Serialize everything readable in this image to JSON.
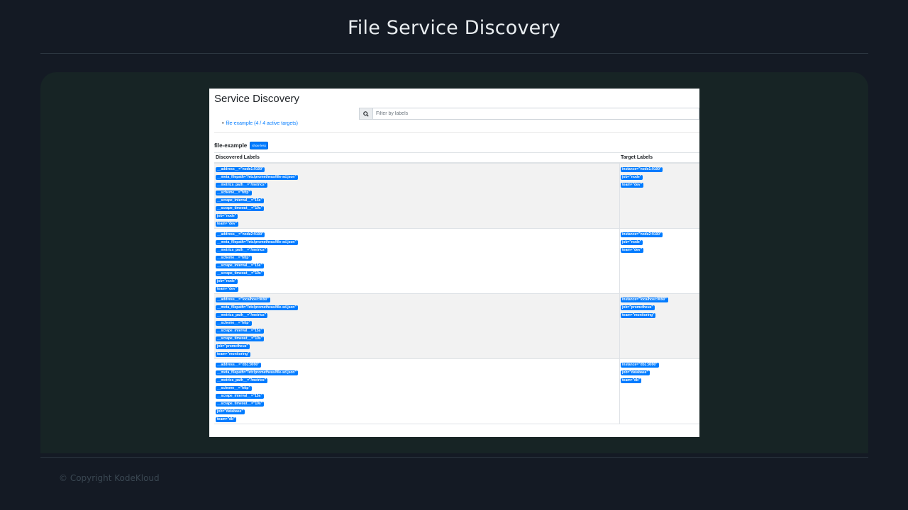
{
  "slide": {
    "title": "File Service Discovery",
    "copyright": "© Copyright KodeKloud"
  },
  "page": {
    "title": "Service Discovery",
    "search": {
      "placeholder": "Filter by labels",
      "icon": "search-icon"
    },
    "jobs_link": "file-example (4 / 4 active targets)",
    "job": {
      "name": "file-example",
      "toggle_label": "show less",
      "col_discovered": "Discovered Labels",
      "col_target": "Target Labels",
      "rows": [
        {
          "discovered": [
            "__address__=\"node1:9100\"",
            "__meta_filepath=\"/etc/prometheus/file-sd.json\"",
            "__metrics_path__=\"/metrics\"",
            "__scheme__=\"http\"",
            "__scrape_interval__=\"15s\"",
            "__scrape_timeout__=\"10s\"",
            "job=\"node\"",
            "team=\"dev\""
          ],
          "target": [
            "instance=\"node1:9100\"",
            "job=\"node\"",
            "team=\"dev\""
          ]
        },
        {
          "discovered": [
            "__address__=\"node2:9100\"",
            "__meta_filepath=\"/etc/prometheus/file-sd.json\"",
            "__metrics_path__=\"/metrics\"",
            "__scheme__=\"http\"",
            "__scrape_interval__=\"15s\"",
            "__scrape_timeout__=\"10s\"",
            "job=\"node\"",
            "team=\"dev\""
          ],
          "target": [
            "instance=\"node2:9100\"",
            "job=\"node\"",
            "team=\"dev\""
          ]
        },
        {
          "discovered": [
            "__address__=\"localhost:9090\"",
            "__meta_filepath=\"/etc/prometheus/file-sd.json\"",
            "__metrics_path__=\"/metrics\"",
            "__scheme__=\"http\"",
            "__scrape_interval__=\"15s\"",
            "__scrape_timeout__=\"10s\"",
            "job=\"prometheus\"",
            "team=\"monitoring\""
          ],
          "target": [
            "instance=\"localhost:9090\"",
            "job=\"prometheus\"",
            "team=\"monitoring\""
          ]
        },
        {
          "discovered": [
            "__address__=\"db1:9090\"",
            "__meta_filepath=\"/etc/prometheus/file-sd.json\"",
            "__metrics_path__=\"/metrics\"",
            "__scheme__=\"http\"",
            "__scrape_interval__=\"15s\"",
            "__scrape_timeout__=\"10s\"",
            "job=\"database\"",
            "team=\"db\""
          ],
          "target": [
            "instance=\"db1:9090\"",
            "job=\"database\"",
            "team=\"db\""
          ]
        }
      ]
    }
  },
  "colors": {
    "badge": "#007bff",
    "background": "#141a24",
    "panel": "#172425"
  }
}
